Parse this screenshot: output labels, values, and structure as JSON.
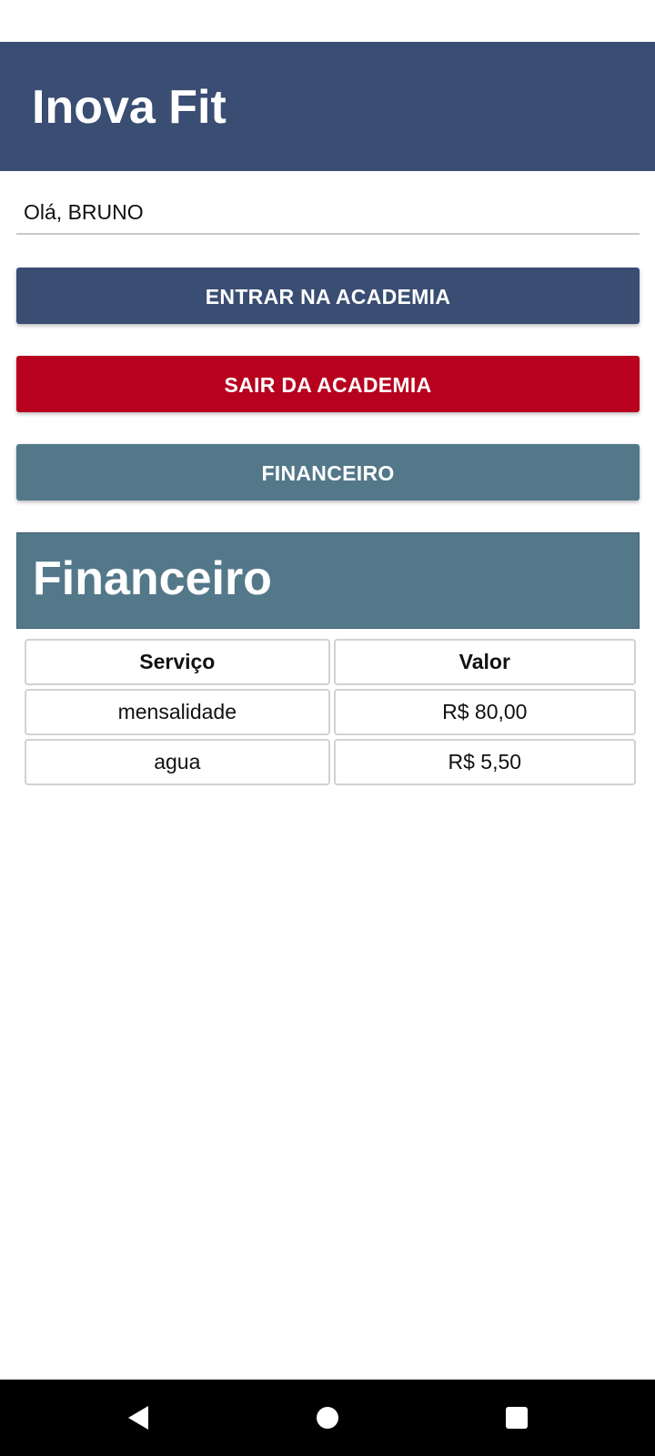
{
  "app": {
    "title": "Inova Fit"
  },
  "greeting": "Olá, BRUNO",
  "buttons": {
    "enter": "ENTRAR NA ACADEMIA",
    "exit": "SAIR DA ACADEMIA",
    "financial": "FINANCEIRO"
  },
  "financial": {
    "title": "Financeiro",
    "columns": [
      "Serviço",
      "Valor"
    ],
    "rows": [
      [
        "mensalidade",
        "R$ 80,00"
      ],
      [
        "agua",
        "R$ 5,50"
      ]
    ]
  },
  "navigation": {
    "back_icon": "back-triangle-icon",
    "home_icon": "home-circle-icon",
    "recents_icon": "recents-square-icon"
  },
  "colors": {
    "header": "#3a4d72",
    "enter_button": "#3a4d72",
    "exit_button": "#b8001f",
    "financial": "#537889"
  }
}
